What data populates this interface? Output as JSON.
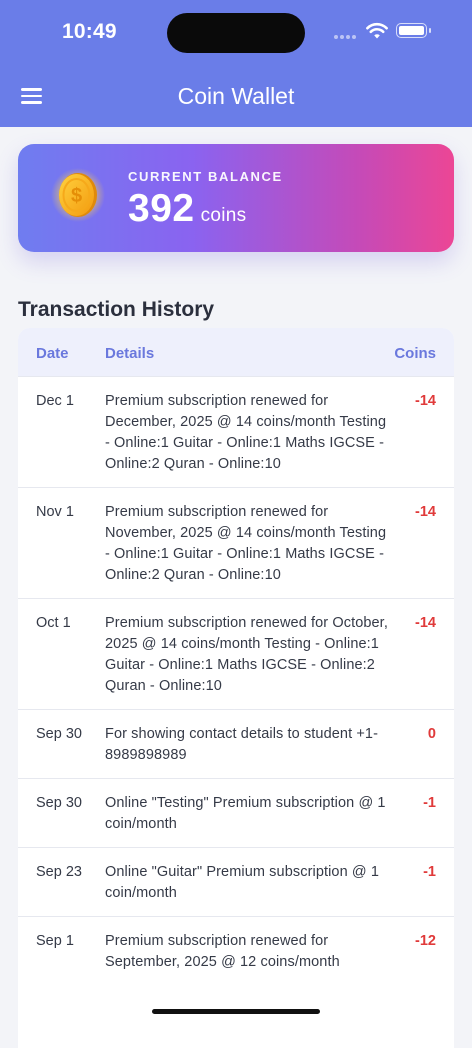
{
  "status_bar": {
    "time": "10:49"
  },
  "header": {
    "title": "Coin Wallet",
    "menu_icon": "hamburger-menu-icon"
  },
  "balance": {
    "label": "CURRENT BALANCE",
    "value": "392",
    "unit": "coins",
    "icon": "dollar-coin-icon",
    "gradient": [
      "#6f7df0",
      "#8a63f0",
      "#c54ab8",
      "#ec4695"
    ]
  },
  "history": {
    "title": "Transaction History",
    "columns": {
      "date": "Date",
      "details": "Details",
      "coins": "Coins"
    },
    "rows": [
      {
        "date": "Dec 1",
        "details": "Premium subscription renewed for December, 2025 @ 14 coins/month Testing - Online:1 Guitar - Online:1 Maths IGCSE - Online:2 Quran - Online:10",
        "coins": "-14"
      },
      {
        "date": "Nov 1",
        "details": "Premium subscription renewed for November, 2025 @ 14 coins/month Testing - Online:1 Guitar - Online:1 Maths IGCSE - Online:2 Quran - Online:10",
        "coins": "-14"
      },
      {
        "date": "Oct 1",
        "details": "Premium subscription renewed for October, 2025 @ 14 coins/month Testing - Online:1 Guitar - Online:1 Maths IGCSE - Online:2 Quran - Online:10",
        "coins": "-14"
      },
      {
        "date": "Sep 30",
        "details": "For showing contact details to student +1-8989898989",
        "coins": "0"
      },
      {
        "date": "Sep 30",
        "details": "Online \"Testing\" Premium subscription @ 1 coin/month",
        "coins": "-1"
      },
      {
        "date": "Sep 23",
        "details": "Online \"Guitar\" Premium subscription @ 1 coin/month",
        "coins": "-1"
      },
      {
        "date": "Sep 1",
        "details": "Premium subscription renewed for September, 2025 @ 12 coins/month",
        "coins": "-12"
      }
    ]
  },
  "colors": {
    "header_bg": "#6a7de8",
    "page_bg": "#f3f4f8",
    "table_head_bg": "#eef0fc",
    "table_head_text": "#6a78dd",
    "debit": "#e03a3a"
  }
}
